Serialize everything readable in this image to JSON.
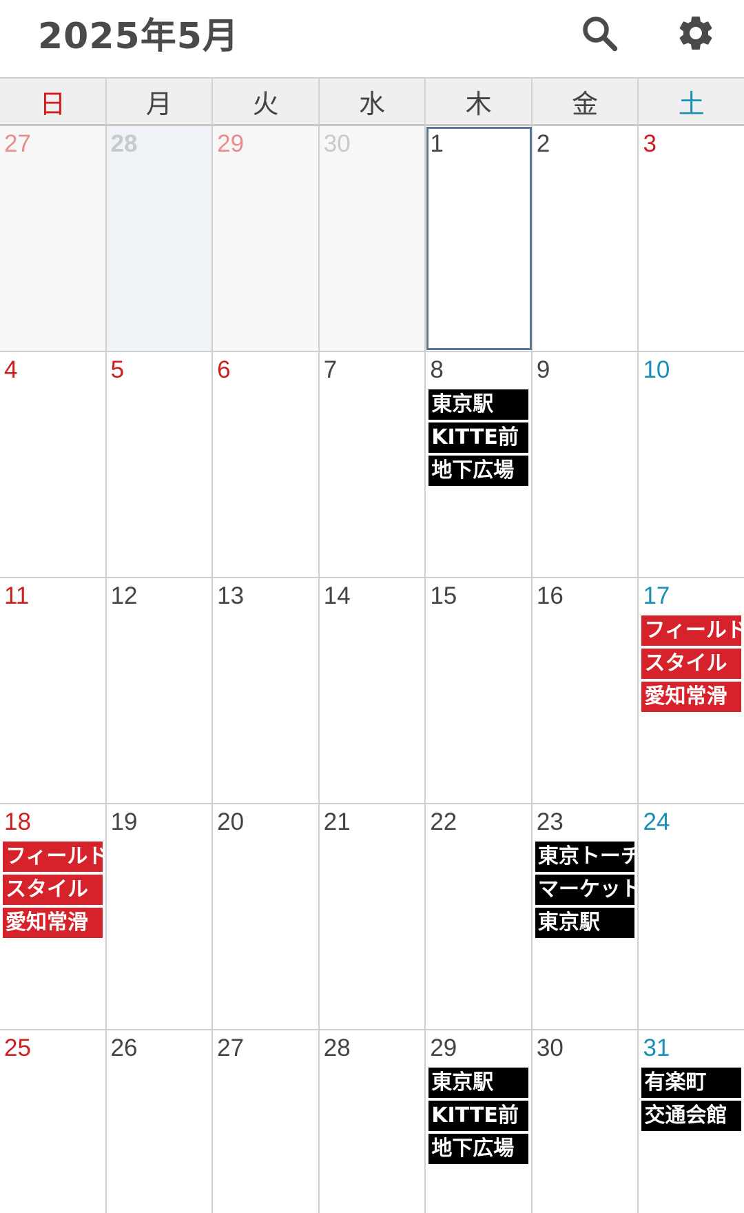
{
  "header": {
    "title": "2025年5月",
    "search_icon": "search-icon",
    "settings_icon": "gear-icon"
  },
  "weekdays": [
    "日",
    "月",
    "火",
    "水",
    "木",
    "金",
    "土"
  ],
  "colors": {
    "sunday": "#d01d1d",
    "saturday": "#1a8fb8",
    "event_black": "#000000",
    "event_red": "#d6232b",
    "today_border": "#5a7493"
  },
  "weeks": [
    [
      {
        "day": "27",
        "other": true,
        "events": []
      },
      {
        "day": "28",
        "other": true,
        "events": []
      },
      {
        "day": "29",
        "other": true,
        "events": []
      },
      {
        "day": "30",
        "other": true,
        "events": []
      },
      {
        "day": "1",
        "today": true,
        "events": []
      },
      {
        "day": "2",
        "events": []
      },
      {
        "day": "3",
        "holiday": true,
        "events": []
      }
    ],
    [
      {
        "day": "4",
        "holiday": true,
        "events": []
      },
      {
        "day": "5",
        "holiday": true,
        "events": []
      },
      {
        "day": "6",
        "holiday": true,
        "events": []
      },
      {
        "day": "7",
        "events": []
      },
      {
        "day": "8",
        "events": [
          {
            "text": "東京駅",
            "color": "black"
          },
          {
            "text": "KITTE前",
            "color": "black"
          },
          {
            "text": "地下広場",
            "color": "black"
          }
        ]
      },
      {
        "day": "9",
        "events": []
      },
      {
        "day": "10",
        "events": []
      }
    ],
    [
      {
        "day": "11",
        "events": []
      },
      {
        "day": "12",
        "events": []
      },
      {
        "day": "13",
        "events": []
      },
      {
        "day": "14",
        "events": []
      },
      {
        "day": "15",
        "events": []
      },
      {
        "day": "16",
        "events": []
      },
      {
        "day": "17",
        "events": [
          {
            "text": "フィールド",
            "color": "red"
          },
          {
            "text": "スタイル",
            "color": "red"
          },
          {
            "text": "愛知常滑",
            "color": "red"
          }
        ]
      }
    ],
    [
      {
        "day": "18",
        "events": [
          {
            "text": "フィールド",
            "color": "red"
          },
          {
            "text": "スタイル",
            "color": "red"
          },
          {
            "text": "愛知常滑",
            "color": "red"
          }
        ]
      },
      {
        "day": "19",
        "events": []
      },
      {
        "day": "20",
        "events": []
      },
      {
        "day": "21",
        "events": []
      },
      {
        "day": "22",
        "events": []
      },
      {
        "day": "23",
        "events": [
          {
            "text": "東京トーチ",
            "color": "black"
          },
          {
            "text": "マーケット",
            "color": "black"
          },
          {
            "text": "東京駅",
            "color": "black"
          }
        ]
      },
      {
        "day": "24",
        "events": []
      }
    ],
    [
      {
        "day": "25",
        "events": []
      },
      {
        "day": "26",
        "events": []
      },
      {
        "day": "27",
        "events": []
      },
      {
        "day": "28",
        "events": []
      },
      {
        "day": "29",
        "events": [
          {
            "text": "東京駅",
            "color": "black"
          },
          {
            "text": "KITTE前",
            "color": "black"
          },
          {
            "text": "地下広場",
            "color": "black"
          }
        ]
      },
      {
        "day": "30",
        "events": []
      },
      {
        "day": "31",
        "events": [
          {
            "text": "有楽町",
            "color": "black"
          },
          {
            "text": "交通会館",
            "color": "black"
          }
        ]
      }
    ]
  ]
}
